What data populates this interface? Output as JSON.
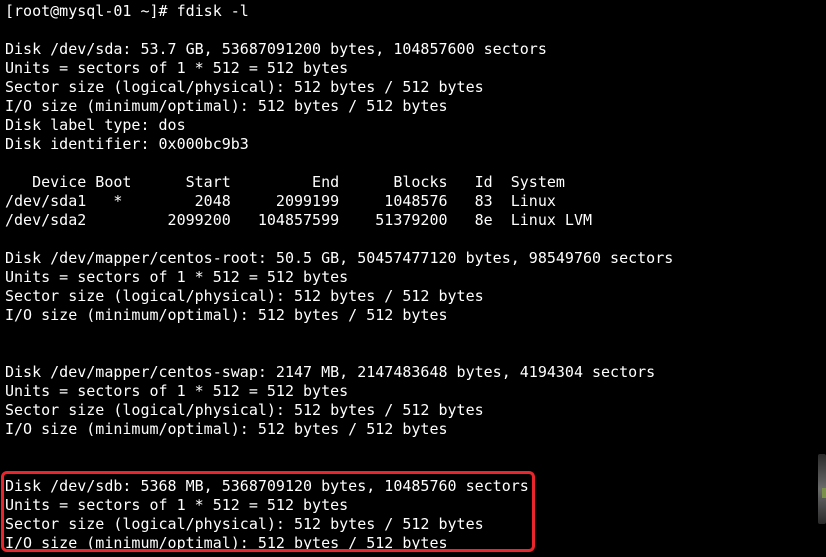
{
  "terminal": {
    "lines": [
      "[root@mysql-01 ~]# fdisk -l",
      "",
      "Disk /dev/sda: 53.7 GB, 53687091200 bytes, 104857600 sectors",
      "Units = sectors of 1 * 512 = 512 bytes",
      "Sector size (logical/physical): 512 bytes / 512 bytes",
      "I/O size (minimum/optimal): 512 bytes / 512 bytes",
      "Disk label type: dos",
      "Disk identifier: 0x000bc9b3",
      "",
      "   Device Boot      Start         End      Blocks   Id  System",
      "/dev/sda1   *        2048     2099199     1048576   83  Linux",
      "/dev/sda2         2099200   104857599    51379200   8e  Linux LVM",
      "",
      "Disk /dev/mapper/centos-root: 50.5 GB, 50457477120 bytes, 98549760 sectors",
      "Units = sectors of 1 * 512 = 512 bytes",
      "Sector size (logical/physical): 512 bytes / 512 bytes",
      "I/O size (minimum/optimal): 512 bytes / 512 bytes",
      "",
      "",
      "Disk /dev/mapper/centos-swap: 2147 MB, 2147483648 bytes, 4194304 sectors",
      "Units = sectors of 1 * 512 = 512 bytes",
      "Sector size (logical/physical): 512 bytes / 512 bytes",
      "I/O size (minimum/optimal): 512 bytes / 512 bytes",
      "",
      "",
      "Disk /dev/sdb: 5368 MB, 5368709120 bytes, 10485760 sectors",
      "Units = sectors of 1 * 512 = 512 bytes",
      "Sector size (logical/physical): 512 bytes / 512 bytes",
      "I/O size (minimum/optimal): 512 bytes / 512 bytes"
    ]
  },
  "colors": {
    "background": "#000000",
    "text": "#ffffff",
    "highlight_border": "#e8262b"
  }
}
